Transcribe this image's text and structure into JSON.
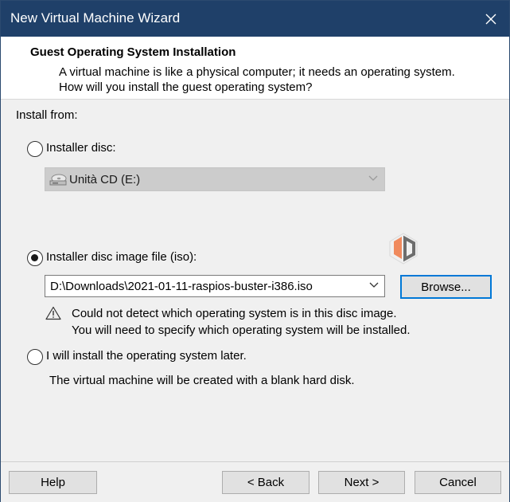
{
  "window": {
    "title": "New Virtual Machine Wizard"
  },
  "header": {
    "title": "Guest Operating System Installation",
    "description": "A virtual machine is like a physical computer; it needs an operating system. How will you install the guest operating system?"
  },
  "install_from_label": "Install from:",
  "installer_disc": {
    "label": "Installer disc:",
    "selected": false,
    "drive_value": "Unità CD (E:)",
    "drive_icon": "cd-drive-icon"
  },
  "iso": {
    "label": "Installer disc image file (iso):",
    "selected": true,
    "path": "D:\\Downloads\\2021-01-11-raspios-buster-i386.iso",
    "browse_label": "Browse...",
    "warning_line1": "Could not detect which operating system is in this disc image.",
    "warning_line2": "You will need to specify which operating system will be installed."
  },
  "later": {
    "label": "I will install the operating system later.",
    "selected": false,
    "note": "The virtual machine will be created with a blank hard disk."
  },
  "footer": {
    "help": "Help",
    "back": "< Back",
    "next": "Next >",
    "cancel": "Cancel"
  },
  "colors": {
    "titlebar": "#1f4069",
    "accent": "#0078d7",
    "watermark_orange": "#f08a5d",
    "watermark_gray": "#6d6d6d"
  }
}
